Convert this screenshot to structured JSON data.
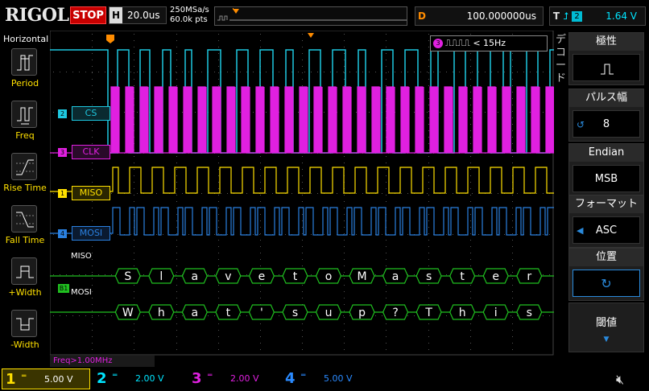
{
  "brand": "RIGOL",
  "status": "STOP",
  "timebase": {
    "key": "H",
    "value": "20.0us"
  },
  "sample": {
    "rate": "250MSa/s",
    "points": "60.0k pts"
  },
  "delay": {
    "key": "D",
    "value": "100.000000us"
  },
  "trigger": {
    "key": "T",
    "channel": "2",
    "level": "1.64 V"
  },
  "left_menu": {
    "title": "Horizontal",
    "items": [
      "Period",
      "Freq",
      "Rise Time",
      "Fall Time",
      "+Width",
      "-Width"
    ]
  },
  "channel_labels": {
    "cs": "CS",
    "clk": "CLK",
    "miso": "MISO",
    "mosi": "MOSI"
  },
  "channel_markers": {
    "cs": "2",
    "clk": "3",
    "miso": "1",
    "mosi": "4",
    "bus": "B1"
  },
  "bus_labels": {
    "miso": "MISO",
    "mosi": "MOSI"
  },
  "decode": {
    "miso_chars": [
      "S",
      "l",
      "a",
      "v",
      "e",
      "t",
      "o",
      "M",
      "a",
      "s",
      "t",
      "e",
      "r"
    ],
    "mosi_chars": [
      "W",
      "h",
      "a",
      "t",
      "'",
      "s",
      "u",
      "p",
      "?",
      "T",
      "h",
      "i",
      "s"
    ]
  },
  "freq_popup": {
    "channel": "3",
    "text": "< 15Hz"
  },
  "freq_readout": "Freq>1.00MHz",
  "right_menu": {
    "side_title": "デコード",
    "polarity": {
      "label": "極性"
    },
    "pulse_width": {
      "label": "パルス幅",
      "value": "8"
    },
    "endian": {
      "label": "Endian",
      "value": "MSB"
    },
    "format": {
      "label": "フォーマット",
      "value": "ASC"
    },
    "position": {
      "label": "位置"
    },
    "threshold": {
      "label": "閾値"
    }
  },
  "channels": [
    {
      "num": "1",
      "volts": "5.00 V",
      "color": "#ffe000"
    },
    {
      "num": "2",
      "volts": "2.00 V",
      "color": "#00e5ff"
    },
    {
      "num": "3",
      "volts": "2.00 V",
      "color": "#e020e0"
    },
    {
      "num": "4",
      "volts": "5.00 V",
      "color": "#2a8aff"
    }
  ],
  "colors": {
    "cs": "#1ec8e0",
    "clk": "#e020e0",
    "miso": "#ffe000",
    "mosi": "#2a80e0",
    "bus": "#20c020",
    "accent": "#2a8adc"
  }
}
